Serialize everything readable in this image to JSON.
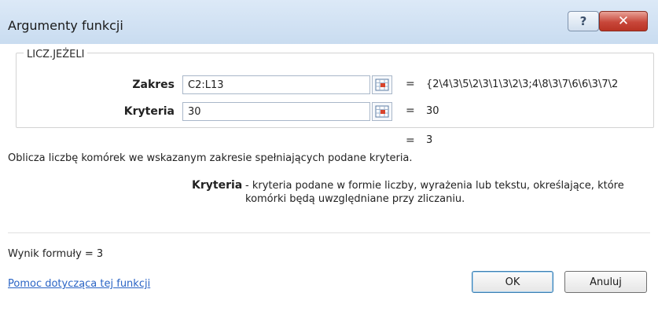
{
  "window": {
    "title": "Argumenty funkcji",
    "help_label": "?",
    "close_label": "✕"
  },
  "function_name": "LICZ.JEŻELI",
  "arguments": [
    {
      "label": "Zakres",
      "value": "C2:L13",
      "evaluated": "{2\\4\\3\\5\\2\\3\\1\\3\\2\\3;4\\8\\3\\7\\6\\6\\3\\7\\2"
    },
    {
      "label": "Kryteria",
      "value": "30",
      "evaluated": "30"
    }
  ],
  "equals_sign": "=",
  "result_value": "3",
  "description": "Oblicza liczbę komórek we wskazanym zakresie spełniających podane kryteria.",
  "parameter": {
    "name": "Kryteria",
    "description": "- kryteria podane w formie liczby, wyrażenia lub tekstu, określające, które komórki będą uwzględniane przy zliczaniu."
  },
  "formula_result": "Wynik formuły =  3",
  "help_link": "Pomoc dotycząca tej funkcji",
  "buttons": {
    "ok": "OK",
    "cancel": "Anuluj"
  },
  "colors": {
    "titlebar": "#c9dcf0",
    "close_button": "#c8473a",
    "link": "#2a64c5"
  }
}
